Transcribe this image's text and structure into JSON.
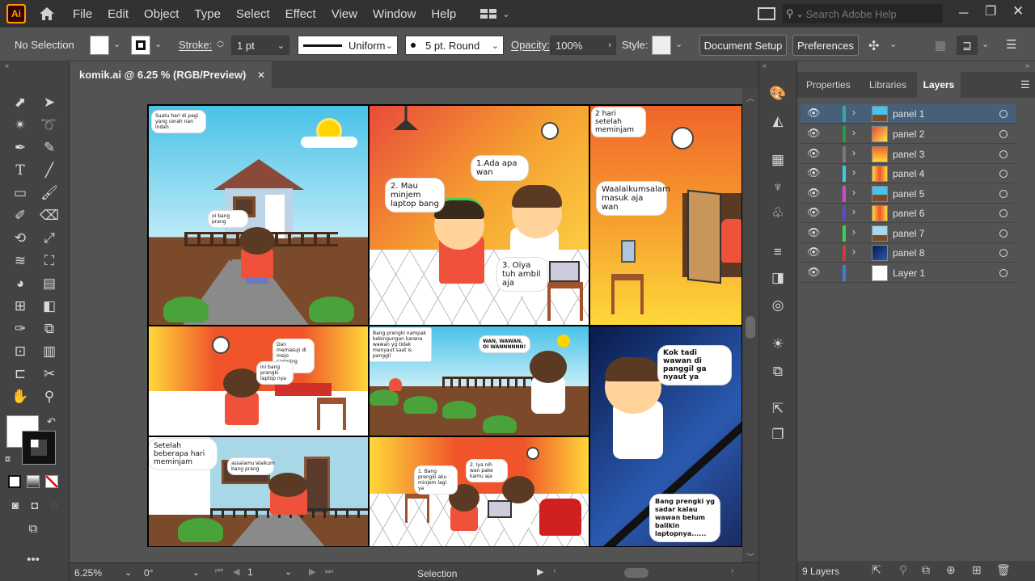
{
  "app": {
    "logo": "Ai",
    "title": "Adobe Illustrator"
  },
  "menu": [
    "File",
    "Edit",
    "Object",
    "Type",
    "Select",
    "Effect",
    "View",
    "Window",
    "Help"
  ],
  "search": {
    "placeholder": "Search Adobe Help"
  },
  "control": {
    "selection": "No Selection",
    "stroke_label": "Stroke:",
    "stroke_weight": "1 pt",
    "profile": "Uniform",
    "brush": "5 pt. Round",
    "opacity_label": "Opacity:",
    "opacity_value": "100%",
    "style_label": "Style:",
    "document_setup": "Document Setup",
    "preferences": "Preferences"
  },
  "document_tab": {
    "title": "komik.ai @ 6.25 % (RGB/Preview)",
    "close": "✕"
  },
  "comic": {
    "b1": "Suatu hari di pagi yang cerah nan indah",
    "b2": "oi bang prang",
    "b3": "2. Mau minjem laptop bang",
    "b4": "1.Ada apa wan",
    "b5": "3. Oiya tuh ambil aja",
    "b6": "2 hari setelah meminjam",
    "b7": "Waalaikumsalam masuk aja wan",
    "b8": "Dan memasuji di mejo camping utama",
    "b9": "ini bang prangki laptop nya",
    "b10": "Bang prengki nampak kebingungan karena wawan yg tidak menyaut saat is panggil",
    "b11": "WAN, WAWAN, OI WANNNNNN!",
    "b12": "Kok tadi wawan di panggil ga nyaut ya",
    "b13": "Setelah beberapa hari meminjam",
    "b14": "assalamu'alaikum bang prang",
    "b15": "1. Bang prengki aku minjem lagi ya",
    "b16": "2. Iya nih wan pake kamu aja",
    "b17": "Bang prengki yg sadar kalau wawan belum balikin laptopnya......"
  },
  "status": {
    "zoom": "6.25%",
    "rotation": "0°",
    "artboard": "1",
    "tool": "Selection"
  },
  "panels": {
    "tabs": [
      "Properties",
      "Libraries",
      "Layers"
    ],
    "active": "Layers"
  },
  "layers": [
    {
      "name": "panel 1",
      "color": "#3aa7a1",
      "selected": true
    },
    {
      "name": "panel 2",
      "color": "#2a9a3a"
    },
    {
      "name": "panel 3",
      "color": "#7a7a7a"
    },
    {
      "name": "panel 4",
      "color": "#3ad0e0"
    },
    {
      "name": "panel 5",
      "color": "#d04ad0"
    },
    {
      "name": "panel 6",
      "color": "#5a4ad0"
    },
    {
      "name": "panel 7",
      "color": "#3ad05a"
    },
    {
      "name": "panel 8",
      "color": "#d03a3a"
    },
    {
      "name": "Layer 1",
      "color": "#4a7ad0"
    }
  ],
  "layers_count": "9 Layers"
}
